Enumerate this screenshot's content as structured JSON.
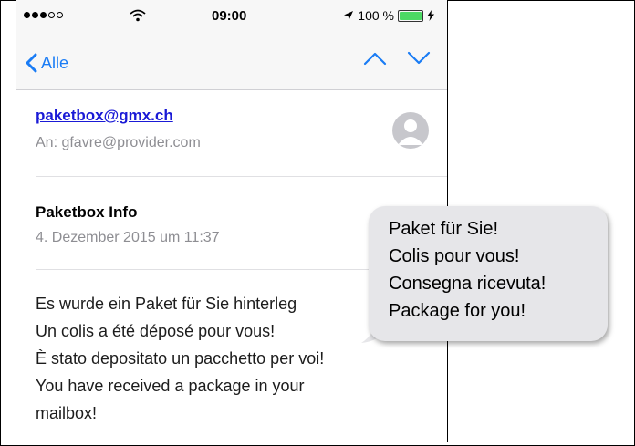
{
  "status_bar": {
    "signal_dots_filled": 3,
    "signal_dots_total": 5,
    "time": "09:00",
    "battery_percent": "100 %",
    "battery_level": 1.0
  },
  "nav": {
    "back_label": "Alle"
  },
  "email": {
    "from": "paketbox@gmx.ch",
    "to": "An: gfavre@provider.com",
    "subject": "Paketbox Info",
    "date": "4. Dezember 2015 um 11:37",
    "body_lines": [
      "Es wurde ein Paket für Sie hinterleg",
      "Un colis a été déposé pour vous!",
      "È stato depositato un pacchetto per voi!",
      "You have received a package in your",
      "mailbox!"
    ]
  },
  "callout": {
    "lines": [
      "Paket für Sie!",
      "Colis pour vous!",
      "Consegna ricevuta!",
      "Package for you!"
    ]
  },
  "colors": {
    "accent": "#1a7cf5",
    "link": "#1a1ad6",
    "secondary_text": "#8e8e93",
    "battery": "#4cd964",
    "bubble": "#e6e6e9"
  }
}
